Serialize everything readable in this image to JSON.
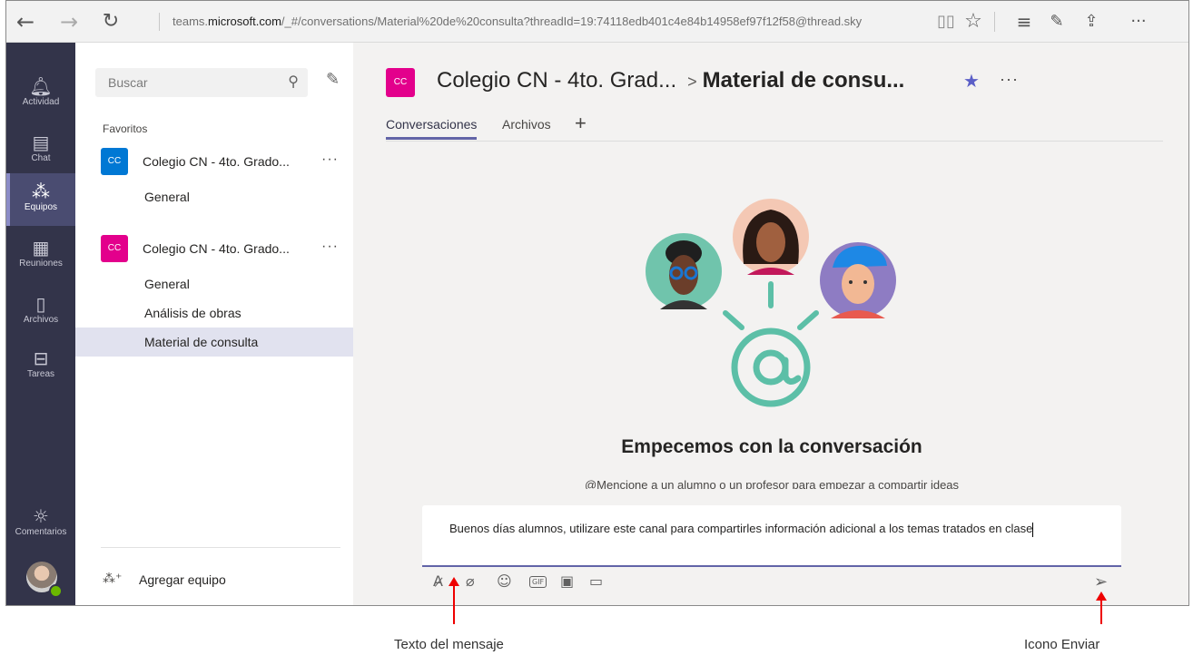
{
  "browser": {
    "url_prefix": "teams.",
    "url_domain": "microsoft.com",
    "url_rest": "/_#/conversations/Material%20de%20consulta?threadId=19:74118edb401c4e84b14958ef97f12f58@thread.sky",
    "icons": [
      "back-icon",
      "forward-icon",
      "refresh-icon",
      "reading-view-icon",
      "favorite-icon",
      "hub-icon",
      "pen-icon",
      "share-icon",
      "more-icon"
    ]
  },
  "rail": {
    "items": [
      {
        "label": "Actividad",
        "icon": "bell-icon"
      },
      {
        "label": "Chat",
        "icon": "chat-icon"
      },
      {
        "label": "Equipos",
        "icon": "teams-icon"
      },
      {
        "label": "Reuniones",
        "icon": "calendar-icon"
      },
      {
        "label": "Archivos",
        "icon": "file-icon"
      },
      {
        "label": "Tareas",
        "icon": "bag-icon"
      }
    ],
    "feedback_label": "Comentarios"
  },
  "sidebar": {
    "search_placeholder": "Buscar",
    "favorites_label": "Favoritos",
    "team1": {
      "initials": "CC",
      "name": "Colegio CN - 4to. Grado...",
      "color": "#0078d4",
      "channels": [
        "General"
      ]
    },
    "team2": {
      "initials": "CC",
      "name": "Colegio CN - 4to. Grado...",
      "color": "#e3008c",
      "channels": [
        "General",
        "Análisis de obras",
        "Material de consulta"
      ]
    },
    "add_team_label": "Agregar equipo",
    "more_label": "···"
  },
  "header": {
    "initials": "CC",
    "team_name": "Colegio CN - 4to. Grad...",
    "separator": ">",
    "channel_name": "Material de consu...",
    "more_label": "···",
    "tabs": [
      "Conversaciones",
      "Archivos"
    ],
    "add_tab": "+"
  },
  "empty_state": {
    "heading": "Empecemos con la conversación",
    "subtext": "@Mencione a un alumno o un profesor para empezar a compartir ideas"
  },
  "composer": {
    "message": "Buenos días alumnos, utilizare este canal para compartirles información adicional a los temas tratados en clase",
    "gif_label": "GIF"
  },
  "annotations": {
    "message_label": "Texto del mensaje",
    "send_label": "Icono Enviar",
    "color": "#e00000"
  },
  "colors": {
    "rail": "#33344a",
    "accent": "#6264a7",
    "brand_pink": "#e3008c",
    "brand_blue": "#0078d4"
  }
}
